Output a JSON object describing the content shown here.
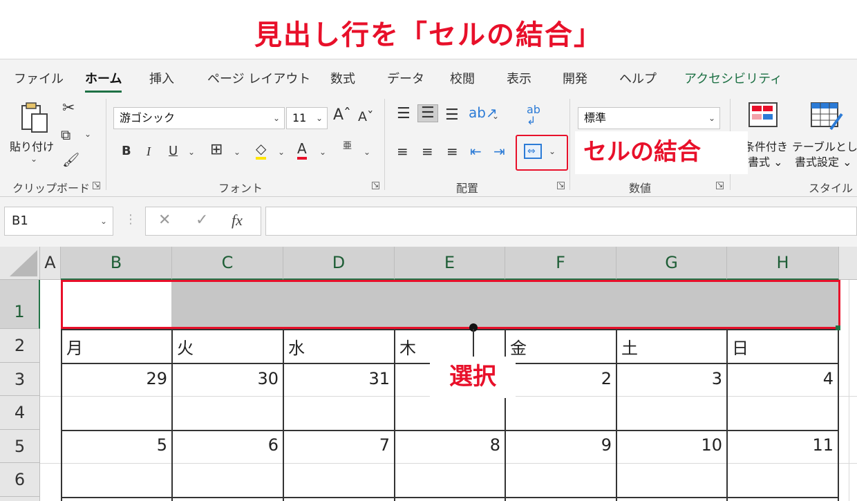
{
  "banner": {
    "title": "見出し行を「セルの結合」"
  },
  "ribbon_tabs": [
    "ファイル",
    "ホーム",
    "挿入",
    "ページ レイアウト",
    "数式",
    "データ",
    "校閲",
    "表示",
    "開発",
    "ヘルプ",
    "アクセシビリティ"
  ],
  "active_tab": "ホーム",
  "clipboard": {
    "paste_label": "貼り付け",
    "group_label": "クリップボード"
  },
  "font": {
    "name": "游ゴシック",
    "size": "11",
    "group_label": "フォント",
    "bold": "B",
    "italic": "I",
    "underline": "U",
    "phonetic": "亜"
  },
  "alignment": {
    "group_label": "配置"
  },
  "number": {
    "format": "標準",
    "group_label": "数値"
  },
  "styles": {
    "conditional_label": "条件付き",
    "conditional_label2": "書式 ⌄",
    "table_label": "テーブルとして",
    "table_label2": "書式設定 ⌄",
    "group_label": "スタイル"
  },
  "callouts": {
    "merge": "セルの結合",
    "select": "選択"
  },
  "formula_bar": {
    "name_box": "B1",
    "fx": "fx",
    "value": ""
  },
  "columns": [
    "A",
    "B",
    "C",
    "D",
    "E",
    "F",
    "G",
    "H"
  ],
  "rows": [
    "1",
    "2",
    "3",
    "4",
    "5",
    "6"
  ],
  "calendar": {
    "days": [
      "月",
      "火",
      "水",
      "木",
      "金",
      "土",
      "日"
    ],
    "week1": [
      "29",
      "30",
      "31",
      "",
      "2",
      "3",
      "4"
    ],
    "week2": [
      "5",
      "6",
      "7",
      "8",
      "9",
      "10",
      "11"
    ]
  },
  "colors": {
    "accent": "#e8102a",
    "excel_green": "#217346"
  }
}
